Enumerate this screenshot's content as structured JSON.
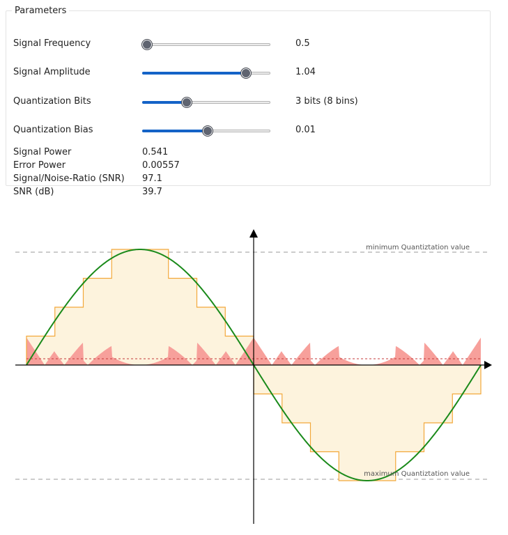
{
  "parameters": {
    "legend": "Parameters",
    "rows": [
      {
        "label": "Signal Frequency",
        "value_text": "0.5",
        "level": 0.04
      },
      {
        "label": "Signal Amplitude",
        "value_text": "1.04",
        "level": 0.81
      },
      {
        "label": "Quantization Bits",
        "value_text": "3 bits (8 bins)",
        "level": 0.35
      },
      {
        "label": "Quantization Bias",
        "value_text": "0.01",
        "level": 0.51
      }
    ]
  },
  "stats": [
    {
      "label": "Signal Power",
      "value": "0.541"
    },
    {
      "label": "Error Power",
      "value": "0.00557"
    },
    {
      "label": "Signal/Noise-Ratio (SNR)",
      "value": "97.1"
    },
    {
      "label": "SNR (dB)",
      "value": "39.7"
    }
  ],
  "plot": {
    "min_label": "minimum Quantiztation value",
    "max_label": "maximum Quantiztation value",
    "colors": {
      "signal": "#1a8a1a",
      "quantized_line": "#f2a83a",
      "quantized_fill": "#fdf3dd",
      "error_fill": "#f7a09b",
      "error_mean": "#c43a3a",
      "guide": "#9a9a9a",
      "axis": "#000000"
    }
  }
}
